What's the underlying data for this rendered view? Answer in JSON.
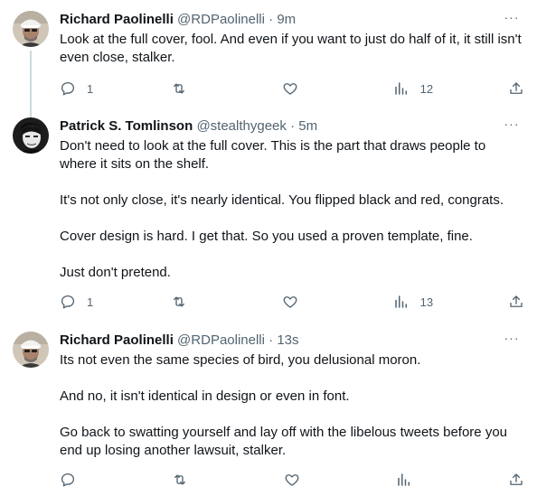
{
  "tweets": [
    {
      "name": "Richard Paolinelli",
      "handle": "@RDPaolinelli",
      "dot": "·",
      "time": "9m",
      "more": "···",
      "paragraphs": [
        "Look at the full cover, fool. And even if you want to just do half of it, it still isn't even close, stalker."
      ],
      "replies": "1",
      "retweets": "",
      "likes": "",
      "views": "12",
      "avatar_icon": "profile-avatar"
    },
    {
      "name": "Patrick S. Tomlinson",
      "handle": "@stealthygeek",
      "dot": "·",
      "time": "5m",
      "more": "···",
      "paragraphs": [
        "Don't need to look at the full cover. This is the part that draws people to where it sits on the shelf.",
        "It's not only close, it's nearly identical. You flipped black and red, congrats.",
        "Cover design is hard. I get that. So you used a proven template, fine.",
        "Just don't pretend."
      ],
      "replies": "1",
      "retweets": "",
      "likes": "",
      "views": "13",
      "avatar_icon": "profile-avatar"
    },
    {
      "name": "Richard Paolinelli",
      "handle": "@RDPaolinelli",
      "dot": "·",
      "time": "13s",
      "more": "···",
      "paragraphs": [
        "Its not even the same species of bird, you delusional moron.",
        "And no, it isn't identical in design or even in font.",
        "Go back to swatting yourself and lay off with the libelous tweets before you end up losing another lawsuit, stalker."
      ],
      "replies": "",
      "retweets": "",
      "likes": "",
      "views": "",
      "avatar_icon": "profile-avatar"
    }
  ],
  "icons": {
    "reply": "reply-icon",
    "retweet": "retweet-icon",
    "like": "heart-icon",
    "views": "views-icon",
    "share": "share-icon",
    "more": "more-icon"
  },
  "colors": {
    "text": "#0f1419",
    "secondary": "#536471",
    "thread_line": "#cfd9de",
    "background": "#ffffff"
  }
}
